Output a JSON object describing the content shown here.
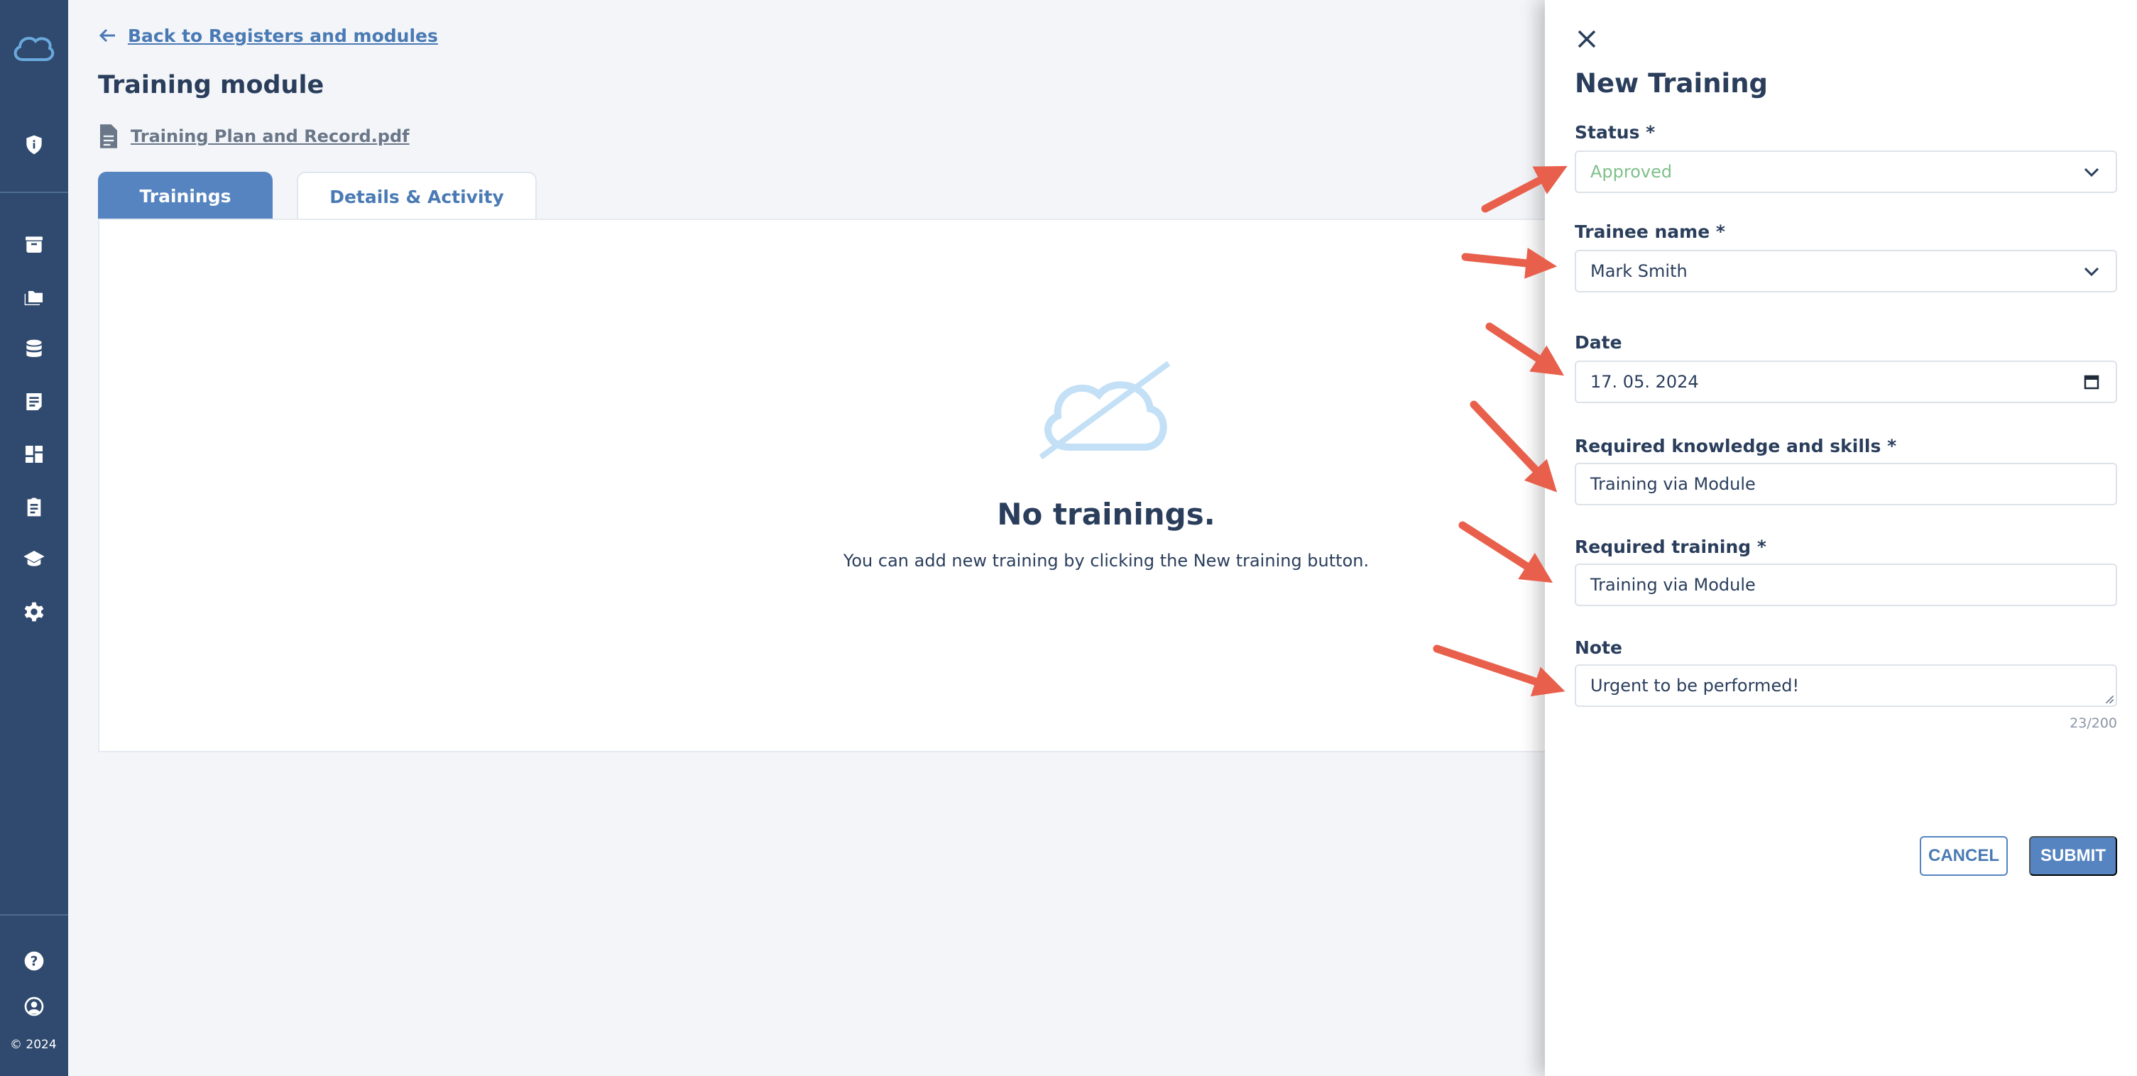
{
  "header": {
    "back_label": "Back to Registers and modules",
    "title": "Training module",
    "file_name": "Training Plan and Record.pdf"
  },
  "tabs": [
    {
      "label": "Trainings",
      "active": true
    },
    {
      "label": "Details & Activity",
      "active": false
    }
  ],
  "empty_state": {
    "title": "No trainings.",
    "subtitle": "You can add new training by clicking the New training button."
  },
  "sidebar": {
    "icons": [
      "cloud-logo-icon",
      "shield-icon",
      "archive-icon",
      "folders-icon",
      "database-icon",
      "notes-icon",
      "dashboard-icon",
      "clipboard-icon",
      "graduation-cap-icon",
      "gear-icon",
      "help-icon",
      "account-icon"
    ],
    "copyright": "© 2024"
  },
  "drawer": {
    "title": "New Training",
    "fields": {
      "status": {
        "label": "Status *",
        "value": "Approved"
      },
      "trainee": {
        "label": "Trainee name *",
        "value": "Mark Smith"
      },
      "date": {
        "label": "Date",
        "value": "17. 05. 2024"
      },
      "knowledge": {
        "label": "Required knowledge and skills *",
        "value": "Training via Module"
      },
      "training": {
        "label": "Required training *",
        "value": "Training via Module"
      },
      "note": {
        "label": "Note",
        "value": "Urgent to be performed!",
        "count": "23/200"
      }
    },
    "cancel_label": "CANCEL",
    "submit_label": "SUBMIT"
  },
  "colors": {
    "sidebar": "#2f4a6e",
    "primary": "#5584c0",
    "annotation_arrow": "#e8604c",
    "status_approved": "#7fc08b"
  }
}
